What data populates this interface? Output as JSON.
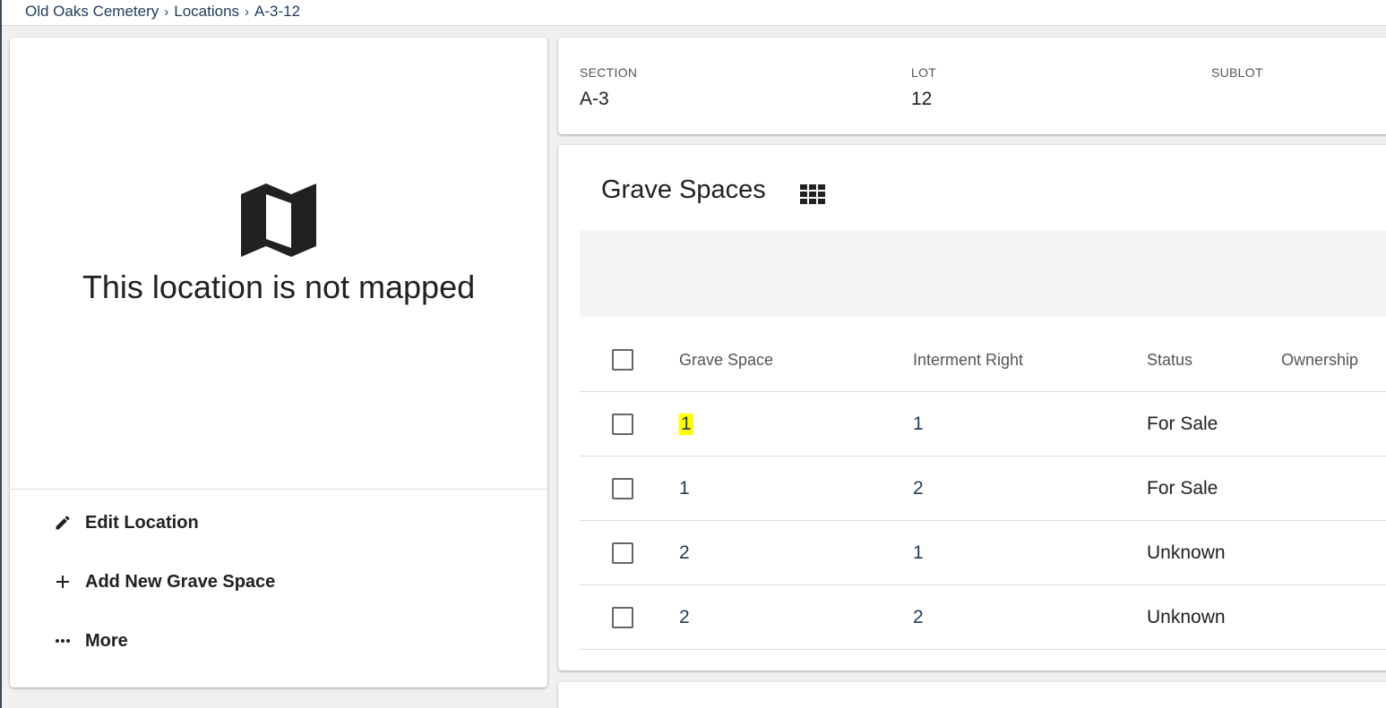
{
  "breadcrumb": {
    "items": [
      "Old Oaks Cemetery",
      "Locations",
      "A-3-12"
    ],
    "separator": "›"
  },
  "map_panel": {
    "icon": "map-icon",
    "message": "This location is not mapped"
  },
  "actions": {
    "edit": {
      "label": "Edit Location",
      "icon": "pencil-icon"
    },
    "add": {
      "label": "Add New Grave Space",
      "icon": "plus-icon"
    },
    "more": {
      "label": "More",
      "icon": "more-dots-icon"
    }
  },
  "location_info": {
    "section": {
      "label": "SECTION",
      "value": "A-3"
    },
    "lot": {
      "label": "LOT",
      "value": "12"
    },
    "sublot": {
      "label": "SUBLOT",
      "value": ""
    }
  },
  "grave_spaces": {
    "title": "Grave Spaces",
    "view_icon": "grid-view-icon",
    "columns": [
      "Grave Space",
      "Interment Right",
      "Status",
      "Ownership"
    ],
    "rows": [
      {
        "grave_space": "1",
        "interment_right": "1",
        "status": "For Sale",
        "ownership": ""
      },
      {
        "grave_space": "1",
        "interment_right": "2",
        "status": "For Sale",
        "ownership": ""
      },
      {
        "grave_space": "2",
        "interment_right": "1",
        "status": "Unknown",
        "ownership": ""
      },
      {
        "grave_space": "2",
        "interment_right": "2",
        "status": "Unknown",
        "ownership": ""
      }
    ]
  },
  "colors": {
    "link": "#1f3b5c",
    "highlight": "#ffff00",
    "page_background": "#f0f0f0"
  }
}
